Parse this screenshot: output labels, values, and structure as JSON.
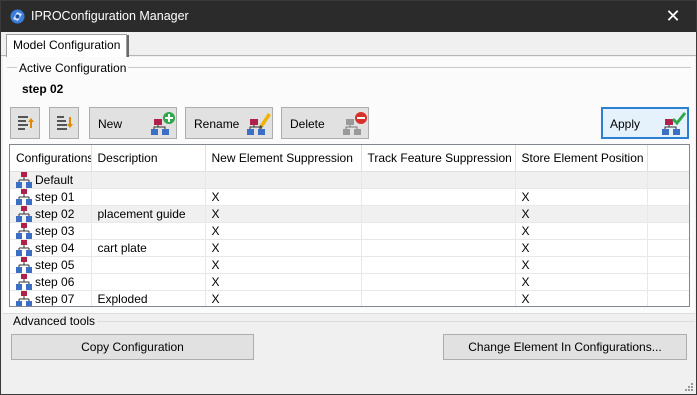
{
  "window": {
    "title": "IPROConfiguration Manager",
    "close_glyph": "✕"
  },
  "tabs": [
    {
      "label": "Model Configuration"
    }
  ],
  "active_config": {
    "group_label": "Active Configuration",
    "value": "step 02"
  },
  "toolbar": {
    "new_label": "New",
    "rename_label": "Rename",
    "delete_label": "Delete",
    "apply_label": "Apply"
  },
  "grid": {
    "columns": [
      "Configurations",
      "Description",
      "New Element Suppression",
      "Track Feature Suppression",
      "Store Element Position"
    ],
    "rows": [
      {
        "name": "Default",
        "description": "",
        "new_el": "",
        "track": "",
        "store": ""
      },
      {
        "name": "step 01",
        "description": "",
        "new_el": "X",
        "track": "",
        "store": "X"
      },
      {
        "name": "step 02",
        "description": "placement guide",
        "new_el": "X",
        "track": "",
        "store": "X"
      },
      {
        "name": "step 03",
        "description": "",
        "new_el": "X",
        "track": "",
        "store": "X"
      },
      {
        "name": "step 04",
        "description": "cart plate",
        "new_el": "X",
        "track": "",
        "store": "X"
      },
      {
        "name": "step 05",
        "description": "",
        "new_el": "X",
        "track": "",
        "store": "X"
      },
      {
        "name": "step 06",
        "description": "",
        "new_el": "X",
        "track": "",
        "store": "X"
      },
      {
        "name": "step 07",
        "description": "Exploded",
        "new_el": "X",
        "track": "",
        "store": "X"
      }
    ]
  },
  "advanced": {
    "group_label": "Advanced tools",
    "copy_label": "Copy Configuration",
    "change_label": "Change Element In Configurations..."
  },
  "colors": {
    "titlebar": "#2b2b2b",
    "accent": "#2d7fd2",
    "tree_blue": "#3a6fc4",
    "default_red": "#b0204a"
  }
}
